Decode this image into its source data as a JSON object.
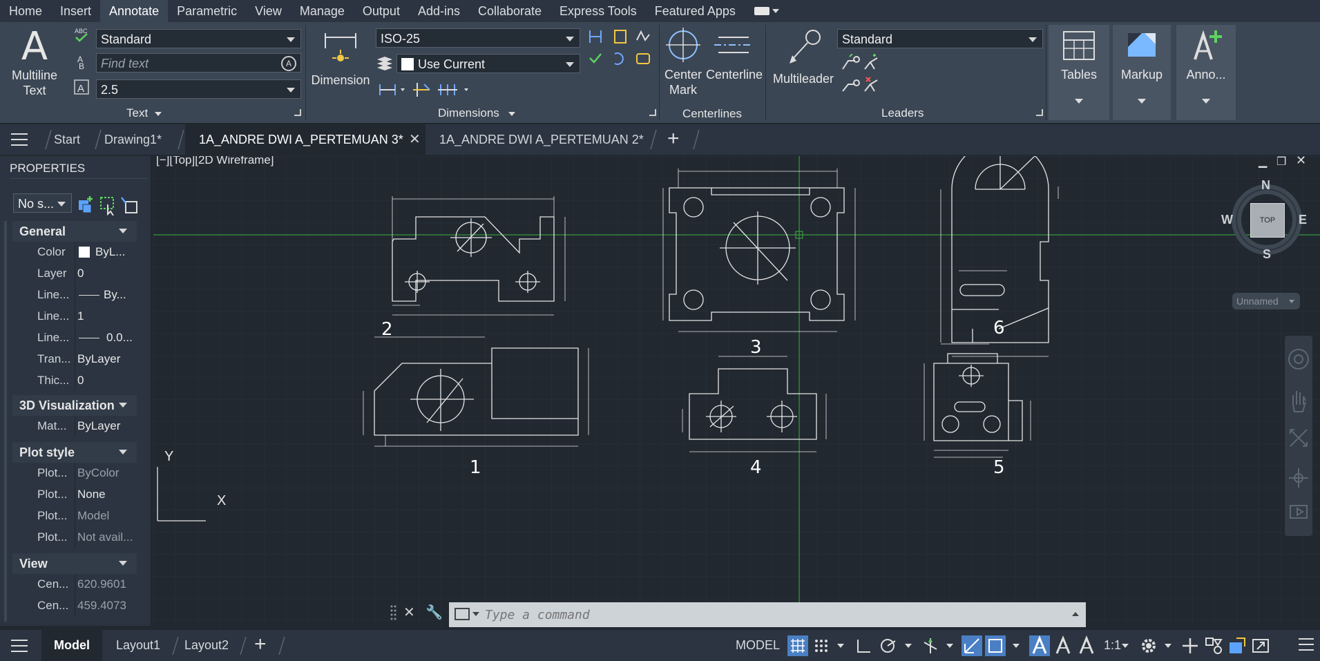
{
  "menu": [
    "Home",
    "Insert",
    "Annotate",
    "Parametric",
    "View",
    "Manage",
    "Output",
    "Add-ins",
    "Collaborate",
    "Express Tools",
    "Featured Apps"
  ],
  "menu_active": "Annotate",
  "ribbon": {
    "text_panel": {
      "big_button_line1": "Multiline",
      "big_button_line2": "Text",
      "style": "Standard",
      "find_placeholder": "Find text",
      "height": "2.5",
      "label": "Text"
    },
    "dimensions_panel": {
      "big_button": "Dimension",
      "style": "ISO-25",
      "layer": "Use Current",
      "label": "Dimensions"
    },
    "centerlines_panel": {
      "center_mark_line1": "Center",
      "center_mark_line2": "Mark",
      "centerline": "Centerline",
      "label": "Centerlines"
    },
    "leaders_panel": {
      "big_button": "Multileader",
      "style": "Standard",
      "label": "Leaders"
    },
    "tables": "Tables",
    "markup": "Markup",
    "anno": "Anno..."
  },
  "tabs": {
    "start": "Start",
    "drawing1": "Drawing1*",
    "active": "1A_ANDRE DWI A_PERTEMUAN 3*",
    "other": "1A_ANDRE DWI A_PERTEMUAN 2*"
  },
  "properties": {
    "title": "PROPERTIES",
    "selection": "No s...",
    "general": "General",
    "rows_general": [
      {
        "k": "Color",
        "v": "ByL..."
      },
      {
        "k": "Layer",
        "v": "0"
      },
      {
        "k": "Line...",
        "v": "By..."
      },
      {
        "k": "Line...",
        "v": "1"
      },
      {
        "k": "Line...",
        "v": "0.0..."
      },
      {
        "k": "Tran...",
        "v": "ByLayer"
      },
      {
        "k": "Thic...",
        "v": "0"
      }
    ],
    "viz": "3D Visualization",
    "rows_viz": [
      {
        "k": "Mat...",
        "v": "ByLayer"
      }
    ],
    "plot": "Plot style",
    "rows_plot": [
      {
        "k": "Plot...",
        "v": "ByColor"
      },
      {
        "k": "Plot...",
        "v": "None"
      },
      {
        "k": "Plot...",
        "v": "Model"
      },
      {
        "k": "Plot...",
        "v": "Not avail..."
      }
    ],
    "view": "View",
    "rows_view": [
      {
        "k": "Cen...",
        "v": "620.9601"
      },
      {
        "k": "Cen...",
        "v": "459.4073"
      }
    ]
  },
  "viewport": {
    "label": "[−][Top][2D Wireframe]",
    "cube": {
      "n": "N",
      "s": "S",
      "e": "E",
      "w": "W",
      "face": "TOP"
    },
    "ucs": "Unnamed",
    "drawing_numbers": [
      "1",
      "2",
      "3",
      "4",
      "5",
      "6"
    ],
    "axis_x": "X",
    "axis_y": "Y"
  },
  "command": {
    "placeholder": "Type a command"
  },
  "status": {
    "model_tab": "Model",
    "layout1": "Layout1",
    "layout2": "Layout2",
    "model": "MODEL",
    "scale": "1:1"
  }
}
